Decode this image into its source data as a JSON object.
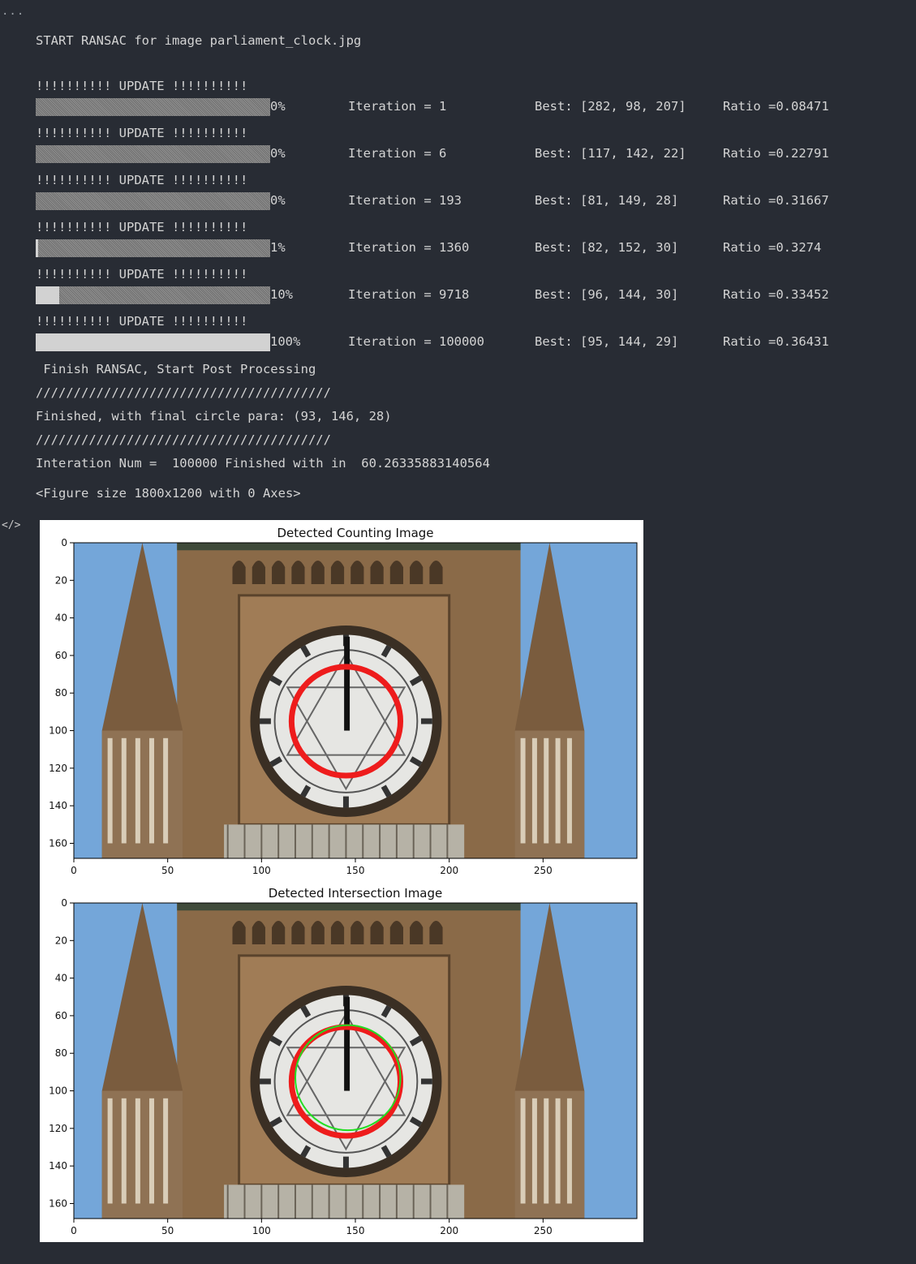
{
  "cell": {
    "ellipsis": "...",
    "code_icon": "</>"
  },
  "output": {
    "start_line": "START RANSAC for image parliament_clock.jpg",
    "update_banner": "!!!!!!!!!! UPDATE !!!!!!!!!!",
    "updates": [
      {
        "percent": "0%",
        "progress": 0.0,
        "iteration": "Iteration = 1",
        "best": "Best: [282, 98, 207]",
        "ratio": "Ratio =0.08471"
      },
      {
        "percent": "0%",
        "progress": 0.0,
        "iteration": "Iteration = 6",
        "best": "Best: [117, 142, 22]",
        "ratio": "Ratio =0.22791"
      },
      {
        "percent": "0%",
        "progress": 0.0,
        "iteration": "Iteration = 193",
        "best": "Best: [81, 149, 28]",
        "ratio": "Ratio =0.31667"
      },
      {
        "percent": "1%",
        "progress": 0.01,
        "iteration": "Iteration = 1360",
        "best": "Best: [82, 152, 30]",
        "ratio": "Ratio =0.3274"
      },
      {
        "percent": "10%",
        "progress": 0.1,
        "iteration": "Iteration = 9718",
        "best": "Best: [96, 144, 30]",
        "ratio": "Ratio =0.33452"
      },
      {
        "percent": "100%",
        "progress": 1.0,
        "iteration": "Iteration = 100000",
        "best": "Best: [95, 144, 29]",
        "ratio": "Ratio =0.36431"
      }
    ],
    "finish_line": " Finish RANSAC, Start Post Processing",
    "separator": "///////////////////////////////////////",
    "final_line": "Finished, with final circle para: (93, 146, 28)",
    "summary_line": "Interation Num =  100000 Finished with in  60.26335883140564",
    "figure_line": "<Figure size 1800x1200 with 0 Axes>"
  },
  "figure": {
    "panels": [
      {
        "title": "Detected Counting Image",
        "red_circle": {
          "row": 95,
          "col": 145,
          "radius": 29
        },
        "green_circle": null
      },
      {
        "title": "Detected Intersection Image",
        "red_circle": {
          "row": 95,
          "col": 145,
          "radius": 29
        },
        "green_circle": {
          "row": 93,
          "col": 146,
          "radius": 28
        }
      }
    ],
    "x_ticks": [
      "0",
      "50",
      "100",
      "150",
      "200",
      "250"
    ],
    "y_ticks": [
      "0",
      "20",
      "40",
      "60",
      "80",
      "100",
      "120",
      "140",
      "160"
    ],
    "colors": {
      "red": "#ee1c1c",
      "green": "#22dd22",
      "sky": "#74a6d9",
      "stone": "#8a6a48"
    }
  }
}
